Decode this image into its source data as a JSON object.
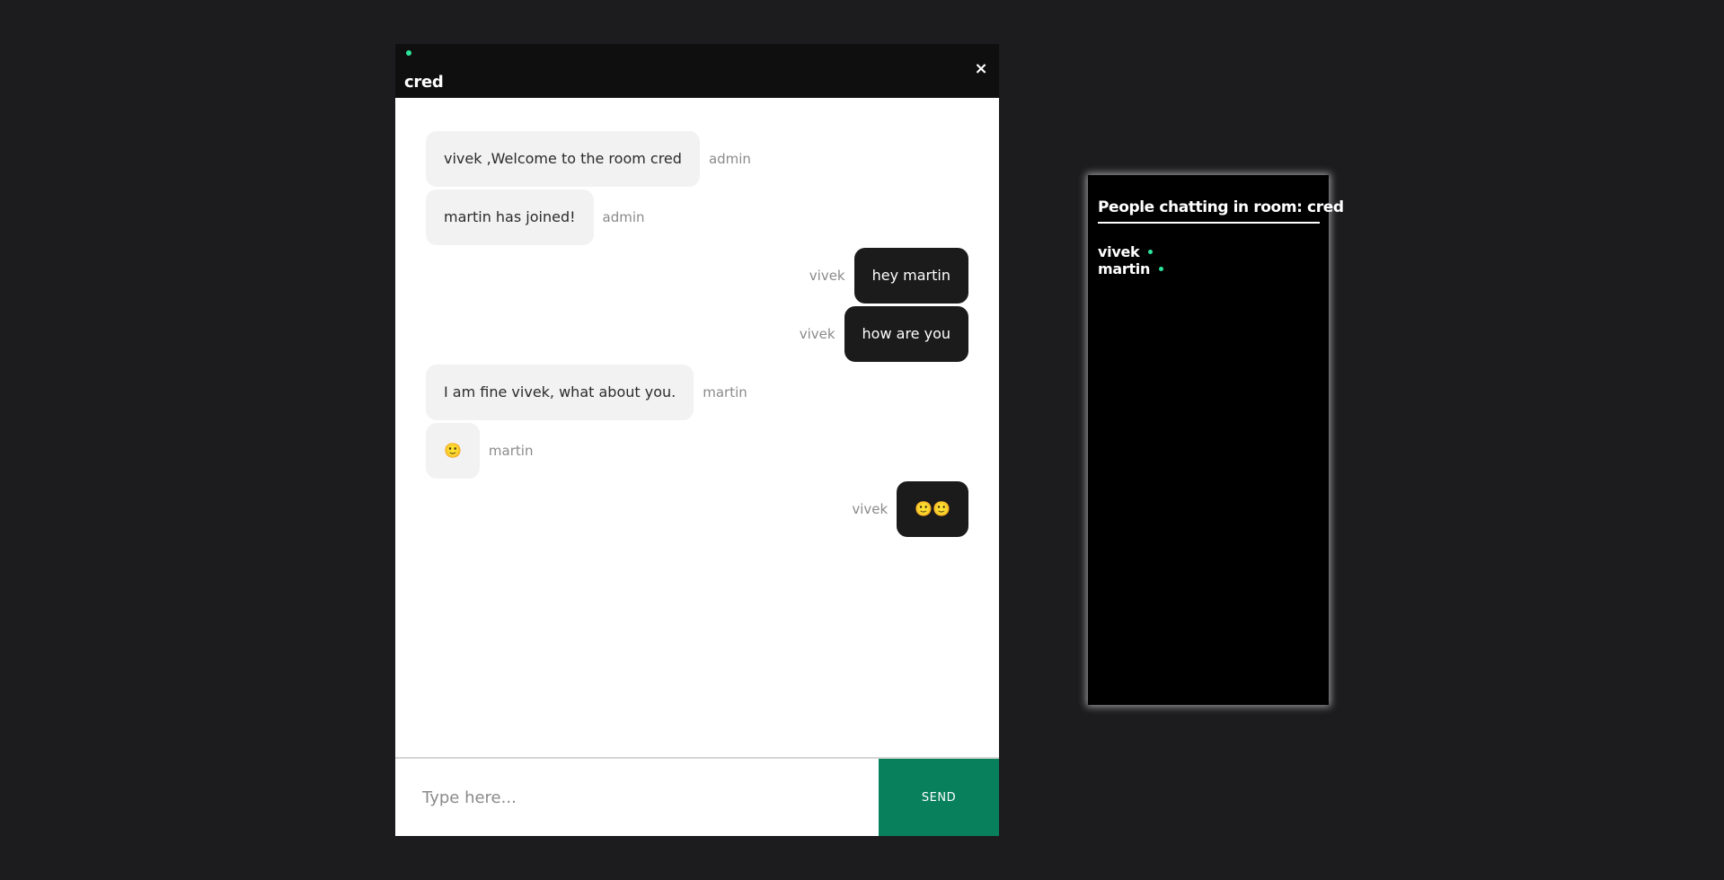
{
  "room": {
    "name": "cred",
    "close_label": "×"
  },
  "messages": [
    {
      "text": "vivek ,Welcome to the room cred",
      "sender": "admin",
      "direction": "received"
    },
    {
      "text": "martin has joined!",
      "sender": "admin",
      "direction": "received"
    },
    {
      "text": "hey martin",
      "sender": "vivek",
      "direction": "sent"
    },
    {
      "text": "how are you",
      "sender": "vivek",
      "direction": "sent"
    },
    {
      "text": "I am fine vivek, what about you.",
      "sender": "martin",
      "direction": "received"
    },
    {
      "text": "🙂",
      "sender": "martin",
      "direction": "received"
    },
    {
      "text": "🙂🙂",
      "sender": "vivek",
      "direction": "sent"
    }
  ],
  "composer": {
    "placeholder": "Type here...",
    "value": "",
    "send_label": "SEND"
  },
  "people_panel": {
    "title": "People chatting in room: cred",
    "people": [
      {
        "name": "vivek",
        "status": "online"
      },
      {
        "name": "martin",
        "status": "online"
      }
    ]
  },
  "colors": {
    "page_bg": "#1c1c1f",
    "header_bg": "#0f0f0f",
    "online": "#2ee59d",
    "send_button": "#08805b",
    "sent_bubble": "#1b1b1b",
    "received_bubble": "#f2f2f2"
  }
}
